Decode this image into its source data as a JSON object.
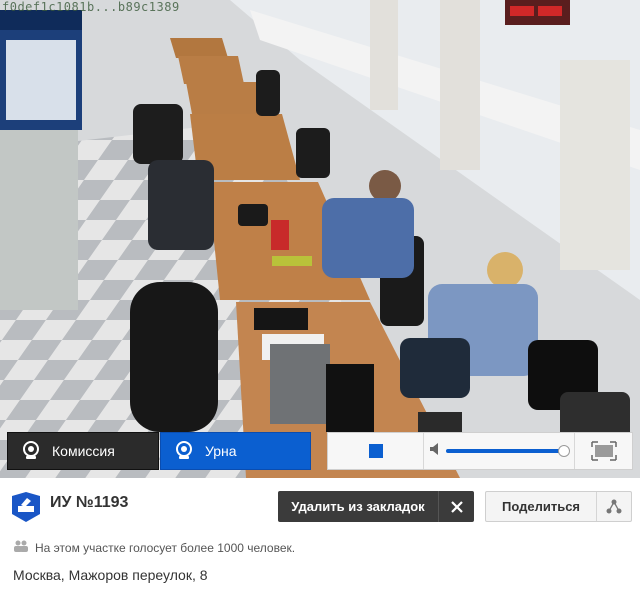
{
  "video": {
    "overlay_id": "f0def1c1081b...b89c1389",
    "scene": "polling-station-room"
  },
  "controls": {
    "commission_label": "Комиссия",
    "urn_label": "Урна",
    "active_camera": "urn",
    "volume_level": 0.95,
    "accent": "#0b5fd0"
  },
  "station": {
    "title": "ИУ №1193",
    "remove_label": "Удалить из закладок",
    "share_label": "Поделиться",
    "voters_text": "На этом участке голосует более 1000 человек.",
    "address": "Москва, Мажоров переулок, 8"
  },
  "icons": {
    "camera": "webcam-icon",
    "stop": "stop-icon",
    "volume": "speaker-icon",
    "fullscreen": "fullscreen-icon",
    "site": "ballot-box-icon",
    "close": "close-icon",
    "share": "share-nodes-icon",
    "people": "people-icon"
  }
}
